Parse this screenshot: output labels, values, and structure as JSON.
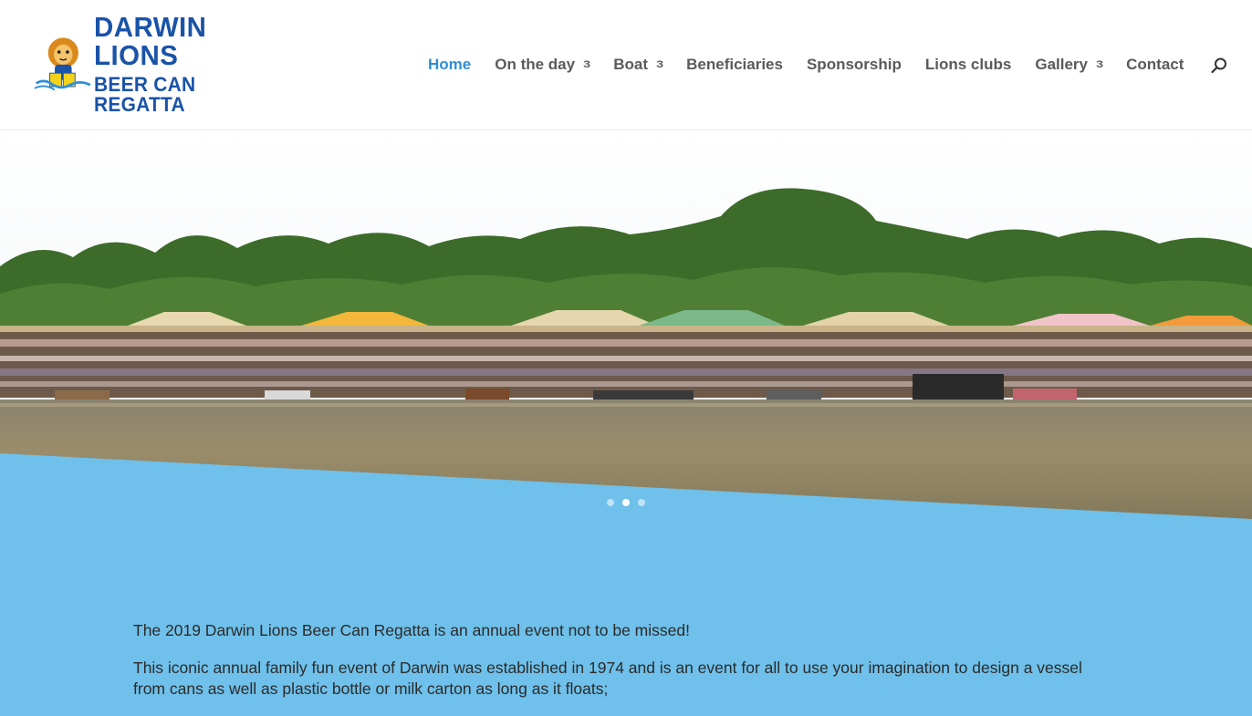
{
  "brand": {
    "line1": "DARWIN LIONS",
    "line2": "BEER CAN REGATTA"
  },
  "nav": {
    "items": [
      {
        "label": "Home",
        "active": true,
        "has_dropdown": false
      },
      {
        "label": "On the day",
        "has_dropdown": true
      },
      {
        "label": "Boat",
        "has_dropdown": true
      },
      {
        "label": "Beneficiaries",
        "has_dropdown": false
      },
      {
        "label": "Sponsorship",
        "has_dropdown": false
      },
      {
        "label": "Lions clubs",
        "has_dropdown": false
      },
      {
        "label": "Gallery",
        "has_dropdown": true
      },
      {
        "label": "Contact",
        "has_dropdown": false
      }
    ],
    "dropdown_glyph": "3"
  },
  "icons": {
    "search": "search-icon",
    "logo": "lion-logo-icon"
  },
  "slider": {
    "slide_count": 3,
    "active_index": 1
  },
  "content": {
    "paragraph1": "The 2019 Darwin Lions Beer Can Regatta is an annual event not to be missed!",
    "paragraph2": "This  iconic annual family fun event of Darwin  was established in 1974 and  is an event for all to use your imagination to design a vessel from  cans as well as  plastic bottle or milk carton as long as it floats;"
  },
  "colors": {
    "accent": "#2e8fd6",
    "brand_blue": "#1a53a8",
    "page_background": "#6fc0ea",
    "nav_text": "#5a5a5a"
  }
}
